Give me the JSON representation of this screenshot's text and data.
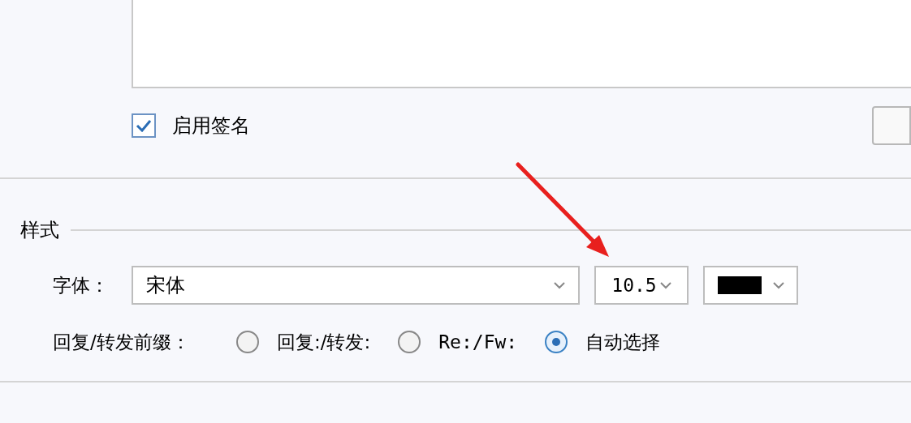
{
  "signature": {
    "enabled": true,
    "label": "启用签名"
  },
  "style": {
    "legend": "样式",
    "font": {
      "label": "字体：",
      "value": "宋体"
    },
    "size": {
      "value": "10.5"
    },
    "color": {
      "color": "#000000"
    },
    "prefix": {
      "label": "回复/转发前缀：",
      "options": [
        {
          "label": "回复:/转发:",
          "selected": false,
          "kind": "text"
        },
        {
          "label": "Re:/Fw:",
          "selected": false,
          "kind": "mono"
        },
        {
          "label": "自动选择",
          "selected": true,
          "kind": "text"
        }
      ]
    }
  }
}
